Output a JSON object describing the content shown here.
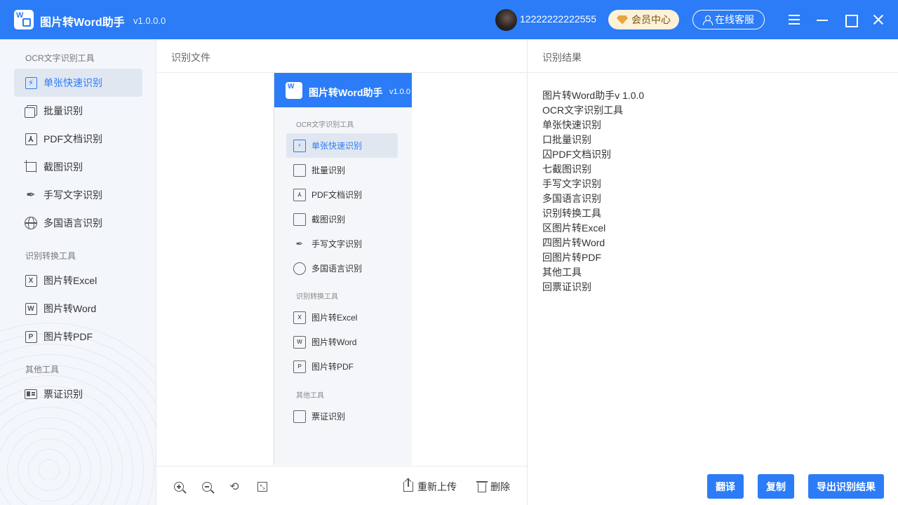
{
  "app": {
    "title": "图片转Word助手",
    "version": "v1.0.0.0"
  },
  "user": {
    "phone": "12222222222555"
  },
  "header": {
    "vip_label": "会员中心",
    "service_label": "在线客服"
  },
  "sidebar": {
    "sections": [
      {
        "title": "OCR文字识别工具",
        "items": [
          {
            "label": "单张快速识别",
            "icon": "lightning-image-icon",
            "active": true
          },
          {
            "label": "批量识别",
            "icon": "copy-icon"
          },
          {
            "label": "PDF文档识别",
            "icon": "pdf-icon"
          },
          {
            "label": "截图识别",
            "icon": "crop-icon"
          },
          {
            "label": "手写文字识别",
            "icon": "pen-icon"
          },
          {
            "label": "多国语言识别",
            "icon": "globe-icon"
          }
        ]
      },
      {
        "title": "识别转换工具",
        "items": [
          {
            "label": "图片转Excel",
            "icon": "excel-icon"
          },
          {
            "label": "图片转Word",
            "icon": "word-icon"
          },
          {
            "label": "图片转PDF",
            "icon": "pdf-file-icon"
          }
        ]
      },
      {
        "title": "其他工具",
        "items": [
          {
            "label": "票证识别",
            "icon": "ticket-icon"
          }
        ]
      }
    ]
  },
  "file_pane": {
    "header": "识别文件",
    "preview": {
      "title": "图片转Word助手",
      "version": "v1.0.0",
      "sections": [
        {
          "title": "OCR文字识别工具",
          "items": [
            "单张快速识别",
            "批量识别",
            "PDF文档识别",
            "截图识别",
            "手写文字识别",
            "多国语言识别"
          ]
        },
        {
          "title": "识别转换工具",
          "items": [
            "图片转Excel",
            "图片转Word",
            "图片转PDF"
          ]
        },
        {
          "title": "其他工具",
          "items": [
            "票证识别"
          ]
        }
      ]
    },
    "toolbar": {
      "reupload_label": "重新上传",
      "delete_label": "删除"
    }
  },
  "result_pane": {
    "header": "识别结果",
    "lines": [
      "图片转Word助手v 1.0.0",
      "OCR文字识别工具",
      "单张快速识别",
      "口批量识别",
      "囚PDF文档识别",
      "七截图识别",
      "手写文字识别",
      "多国语言识别",
      "识别转换工具",
      "区图片转Excel",
      "四图片转Word",
      "回图片转PDF",
      "其他工具",
      "回票证识别"
    ],
    "buttons": {
      "translate": "翻译",
      "copy": "复制",
      "export": "导出识别结果"
    }
  },
  "colors": {
    "primary": "#2b7cf6",
    "sidebar_bg": "#f3f6fb",
    "active_bg": "#e1e7f1"
  }
}
